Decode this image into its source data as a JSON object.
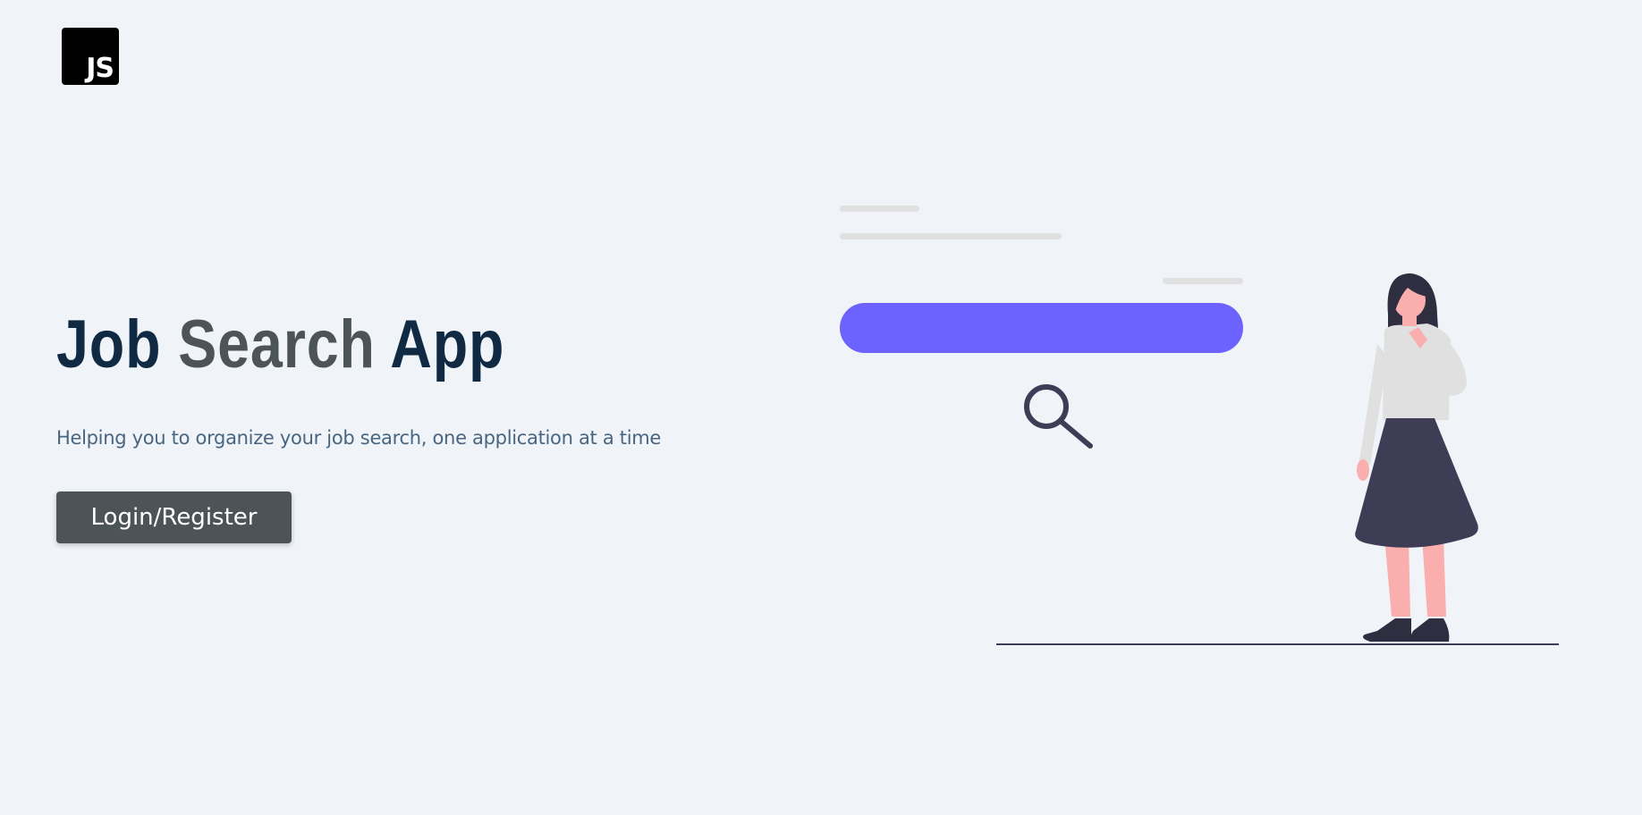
{
  "brand": {
    "logo_text": "JS",
    "logo_bg": "#000000"
  },
  "hero": {
    "title_part1": "Job",
    "title_part2": "Search",
    "title_part3": "App",
    "subtitle": "Helping you to organize your job search, one application at a time",
    "cta_label": "Login/Register"
  },
  "colors": {
    "background": "#f0f4f8",
    "title_primary": "#102a43",
    "title_accent": "#4d5457",
    "button_bg": "#4d5457",
    "search_bar": "#6c63ff",
    "figure_dark": "#3f3d56",
    "skin": "#fbaeae"
  },
  "illustration": {
    "name": "woman-searching-illustration",
    "icon": "magnifier-icon"
  }
}
